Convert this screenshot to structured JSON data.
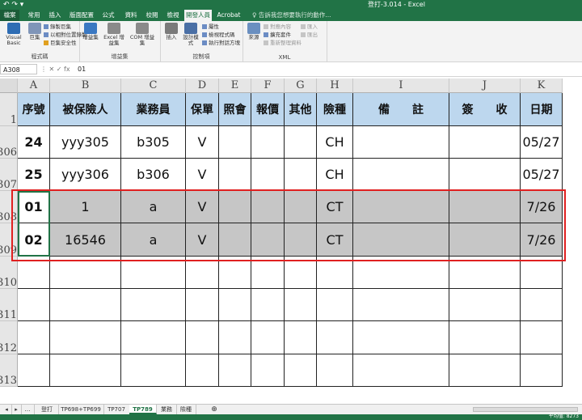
{
  "window": {
    "title": "登打-3.014 - Excel"
  },
  "ribbon_tabs": [
    "檔案",
    "常用",
    "插入",
    "版面配置",
    "公式",
    "資料",
    "校閱",
    "檢視",
    "開發人員",
    "Acrobat"
  ],
  "active_ribbon_tab": "開發人員",
  "tell_me": "告訴我您想要執行的動作...",
  "ribbon": {
    "code_group": {
      "label": "程式碼",
      "visual_basic": "Visual Basic",
      "macros": "巨集",
      "record_macro": "錄製巨集",
      "relative_ref": "以相對位置錄製",
      "macro_security": "巨集安全性"
    },
    "addins_group": {
      "label": "增益集",
      "addins": "增益集",
      "excel_addins": "Excel 增益集",
      "com_addins": "COM 增益集"
    },
    "controls_group": {
      "label": "控制項",
      "insert": "插入",
      "design_mode": "設計模式",
      "properties": "屬性",
      "view_code": "檢視程式碼",
      "run_dialog": "執行對話方塊"
    },
    "xml_group": {
      "label": "XML",
      "source": "來源",
      "map_properties": "對應內容",
      "expansion_packs": "擴充套件",
      "refresh_data": "重新整理資料",
      "import": "匯入",
      "export": "匯出"
    }
  },
  "formula_bar": {
    "name_box": "A308",
    "value": "01"
  },
  "columns": [
    "A",
    "B",
    "C",
    "D",
    "E",
    "F",
    "G",
    "H",
    "I",
    "J",
    "K"
  ],
  "row_numbers": [
    "1",
    "306",
    "307",
    "308",
    "309",
    "310",
    "311",
    "312",
    "313"
  ],
  "header_row": [
    "序號",
    "被保險人",
    "業務員",
    "保單",
    "照會",
    "報價",
    "其他",
    "險種",
    "備　　註",
    "簽　　收",
    "日期"
  ],
  "rows": [
    [
      "24",
      "yyy305",
      "b305",
      "V",
      "",
      "",
      "",
      "CH",
      "",
      "",
      "05/27"
    ],
    [
      "25",
      "yyy306",
      "b306",
      "V",
      "",
      "",
      "",
      "CH",
      "",
      "",
      "05/27"
    ],
    [
      "01",
      "1",
      "a",
      "V",
      "",
      "",
      "",
      "CT",
      "",
      "",
      "7/26"
    ],
    [
      "02",
      "16546",
      "a",
      "V",
      "",
      "",
      "",
      "CT",
      "",
      "",
      "7/26"
    ],
    [
      "",
      "",
      "",
      "",
      "",
      "",
      "",
      "",
      "",
      "",
      ""
    ],
    [
      "",
      "",
      "",
      "",
      "",
      "",
      "",
      "",
      "",
      "",
      ""
    ],
    [
      "",
      "",
      "",
      "",
      "",
      "",
      "",
      "",
      "",
      "",
      ""
    ],
    [
      "",
      "",
      "",
      "",
      "",
      "",
      "",
      "",
      "",
      "",
      ""
    ]
  ],
  "sheet_tabs": [
    "登打",
    "TP698+TP699",
    "TP707",
    "TP789",
    "業務",
    "險種"
  ],
  "active_sheet": "TP789",
  "status": {
    "average": "平均值: 8273"
  },
  "colors": {
    "excel_green": "#217346",
    "header_fill": "#bdd7ee",
    "selection_gray": "#c6c6c6",
    "highlight_red": "#e02020"
  }
}
